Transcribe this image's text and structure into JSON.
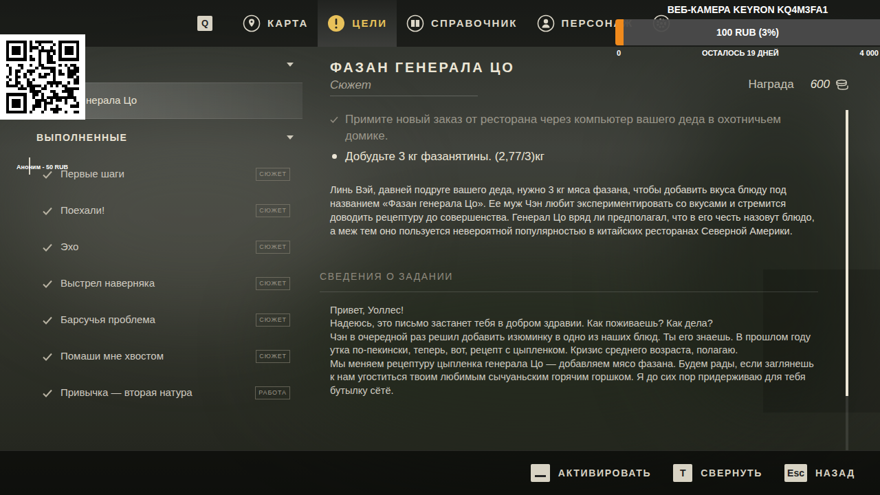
{
  "nav": {
    "key": "Q",
    "tabs": [
      {
        "label": "КАРТА",
        "selected": false
      },
      {
        "label": "ЦЕЛИ",
        "selected": true
      },
      {
        "label": "СПРАВОЧНИК",
        "selected": false
      },
      {
        "label": "ПЕРСОНАЖ",
        "selected": false
      }
    ]
  },
  "stream_overlay": {
    "webcam": "ВЕБ-КАМЕРА KEYRON KQ4M3FA1",
    "goal": {
      "label": "100 RUB (3%)",
      "level": 0.03,
      "min": "0",
      "remaining": "ОСТАЛОСЬ 19 ДНЕЙ",
      "max": "4 000"
    },
    "donation": "Аноним - 50 RUB"
  },
  "quest_list": {
    "current": {
      "expanded": true,
      "items": [
        {
          "label": "нерала Цо",
          "selected": true
        }
      ]
    },
    "completed": {
      "label": "ВЫПОЛНЕННЫЕ",
      "expanded": true,
      "items": [
        {
          "label": "Первые шаги",
          "tag": "СЮЖЕТ",
          "done": true,
          "hovered": true
        },
        {
          "label": "Поехали!",
          "tag": "СЮЖЕТ",
          "done": true,
          "hovered": false
        },
        {
          "label": "Эхо",
          "tag": "СЮЖЕТ",
          "done": true,
          "hovered": false
        },
        {
          "label": "Выстрел наверняка",
          "tag": "СЮЖЕТ",
          "done": true,
          "hovered": false
        },
        {
          "label": "Барсучья проблема",
          "tag": "СЮЖЕТ",
          "done": true,
          "hovered": false
        },
        {
          "label": "Помаши мне хвостом",
          "tag": "СЮЖЕТ",
          "done": true,
          "hovered": false
        },
        {
          "label": "Привычка — вторая натура",
          "tag": "РАБОТА",
          "done": true,
          "hovered": false
        }
      ]
    }
  },
  "quest": {
    "title": "ФАЗАН ГЕНЕРАЛА ЦО",
    "category": "Сюжет",
    "reward_label": "Награда",
    "reward": "600",
    "objectives": [
      {
        "text": "Примите новый заказ от ресторана через компьютер вашего деда в охотничьем домике.",
        "done": true
      },
      {
        "text": "Добудьте 3 кг фазанятины. (2,77/3)кг",
        "done": false
      }
    ],
    "description": "Линь Вэй, давней подруге вашего деда, нужно 3 кг мяса фазана, чтобы добавить вкуса блюду под названием «Фазан генерала Цо». Ее муж Чэн любит экспериментировать со вкусами и стремится доводить рецептуру до совершенства. Генерал Цо вряд ли предполагал, что в его честь назовут блюдо, а меж тем оно пользуется невероятной популярностью в китайских ресторанах Северной Америки.",
    "details_heading": "СВЕДЕНИЯ О ЗАДАНИИ",
    "letter": [
      "Привет, Уоллес!",
      "Надеюсь, это письмо застанет тебя в добром здравии. Как поживаешь? Как дела?",
      "Чэн в очередной раз решил добавить изюминку в одно из наших блюд. Ты его знаешь. В прошлом году утка по-пекински, теперь, вот, рецепт с цыпленком. Кризис среднего возраста, полагаю.",
      "Мы меняем рецептуру цыпленка генерала Цо — добавляем мясо фазана. Будем рады, если заглянешь к нам угоститься твоим любимым сычуаньским горячим горшком. Я до сих пор придерживаю для тебя бутылку сётё."
    ]
  },
  "scrollbar": {
    "level": 0.8
  },
  "footer": {
    "hints": [
      {
        "kind": "space",
        "label": "АКТИВИРОВАТЬ"
      },
      {
        "kind": "key",
        "key": "T",
        "label": "СВЕРНУТЬ"
      },
      {
        "kind": "key",
        "key": "Esc",
        "label": "НАЗАД"
      }
    ]
  }
}
